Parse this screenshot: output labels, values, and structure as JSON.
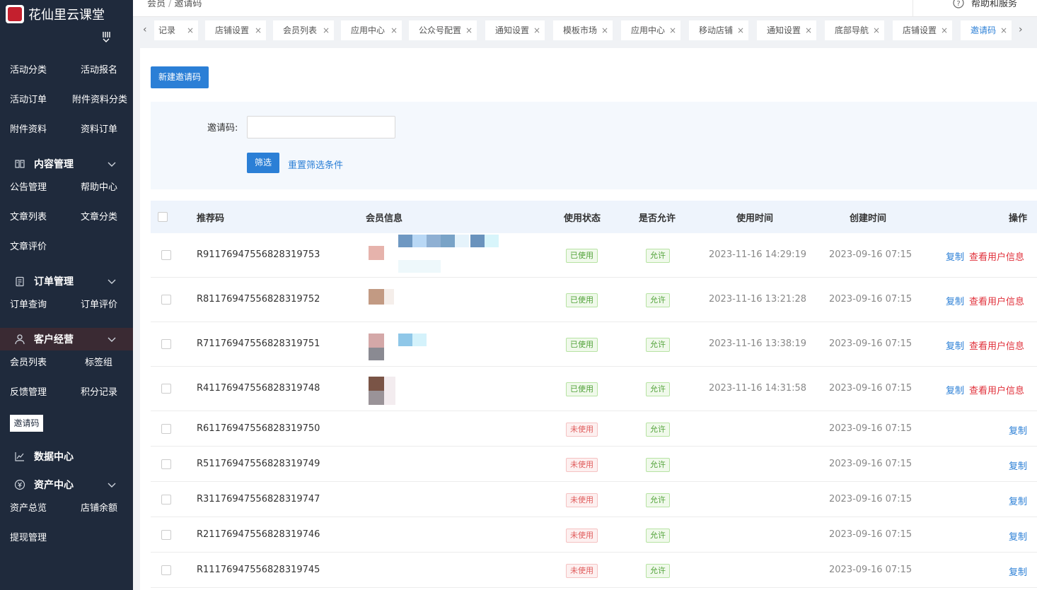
{
  "brand": {
    "title": "花仙里云课堂"
  },
  "sidebar": {
    "items_top": [
      "活动分类",
      "活动报名",
      "活动订单",
      "附件资料分类",
      "附件资料",
      "资料订单"
    ],
    "content_group": {
      "label": "内容管理",
      "items": [
        "公告管理",
        "帮助中心",
        "文章列表",
        "文章分类",
        "文章评价"
      ]
    },
    "order_group": {
      "label": "订单管理",
      "items": [
        "订单查询",
        "订单评价"
      ]
    },
    "customer_group": {
      "label": "客户经营",
      "items": [
        "会员列表",
        "标签组",
        "反馈管理",
        "积分记录"
      ],
      "selected": "邀请码"
    },
    "data_group": {
      "label": "数据中心"
    },
    "asset_group": {
      "label": "资产中心",
      "items": [
        "资产总览",
        "店铺余额",
        "提现管理"
      ]
    }
  },
  "breadcrumb": {
    "parent": "会员",
    "current": "邀请码",
    "sep": "/"
  },
  "help": {
    "label": "帮助和服务"
  },
  "tabs": [
    {
      "label": "记录",
      "active": false
    },
    {
      "label": "店铺设置",
      "active": false
    },
    {
      "label": "会员列表",
      "active": false
    },
    {
      "label": "应用中心",
      "active": false
    },
    {
      "label": "公众号配置",
      "active": false
    },
    {
      "label": "通知设置",
      "active": false
    },
    {
      "label": "模板市场",
      "active": false
    },
    {
      "label": "应用中心",
      "active": false
    },
    {
      "label": "移动店铺",
      "active": false
    },
    {
      "label": "通知设置",
      "active": false
    },
    {
      "label": "底部导航",
      "active": false
    },
    {
      "label": "店铺设置",
      "active": false
    },
    {
      "label": "邀请码",
      "active": true
    }
  ],
  "toolbar": {
    "new_button": "新建邀请码"
  },
  "filter": {
    "label": "邀请码:",
    "value": "",
    "submit": "筛选",
    "reset": "重置筛选条件"
  },
  "table": {
    "headers": {
      "code": "推荐码",
      "member": "会员信息",
      "status": "使用状态",
      "allow": "是否允许",
      "used_at": "使用时间",
      "created_at": "创建时间",
      "ops": "操作"
    },
    "rows": [
      {
        "code": "R91176947556828319753",
        "status": "已使用",
        "allow": "允许",
        "used_at": "2023-11-16 14:29:19",
        "created_at": "2023-09-16 07:15",
        "copy": "复制",
        "view": "查看用户信息"
      },
      {
        "code": "R81176947556828319752",
        "status": "已使用",
        "allow": "允许",
        "used_at": "2023-11-16 13:21:28",
        "created_at": "2023-09-16 07:15",
        "copy": "复制",
        "view": "查看用户信息"
      },
      {
        "code": "R71176947556828319751",
        "status": "已使用",
        "allow": "允许",
        "used_at": "2023-11-16 13:38:19",
        "created_at": "2023-09-16 07:15",
        "copy": "复制",
        "view": "查看用户信息"
      },
      {
        "code": "R41176947556828319748",
        "status": "已使用",
        "allow": "允许",
        "used_at": "2023-11-16 14:31:58",
        "created_at": "2023-09-16 07:15",
        "copy": "复制",
        "view": "查看用户信息"
      },
      {
        "code": "R61176947556828319750",
        "status": "未使用",
        "allow": "允许",
        "used_at": "",
        "created_at": "2023-09-16 07:15",
        "copy": "复制",
        "view": ""
      },
      {
        "code": "R51176947556828319749",
        "status": "未使用",
        "allow": "允许",
        "used_at": "",
        "created_at": "2023-09-16 07:15",
        "copy": "复制",
        "view": ""
      },
      {
        "code": "R31176947556828319747",
        "status": "未使用",
        "allow": "允许",
        "used_at": "",
        "created_at": "2023-09-16 07:15",
        "copy": "复制",
        "view": ""
      },
      {
        "code": "R21176947556828319746",
        "status": "未使用",
        "allow": "允许",
        "used_at": "",
        "created_at": "2023-09-16 07:15",
        "copy": "复制",
        "view": ""
      },
      {
        "code": "R11176947556828319745",
        "status": "未使用",
        "allow": "允许",
        "used_at": "",
        "created_at": "2023-09-16 07:15",
        "copy": "复制",
        "view": ""
      }
    ]
  },
  "colors": {
    "sidebar_bg": "#1f2a3c",
    "primary": "#2b7fd6",
    "danger": "#e0303a",
    "success": "#52a33a"
  }
}
